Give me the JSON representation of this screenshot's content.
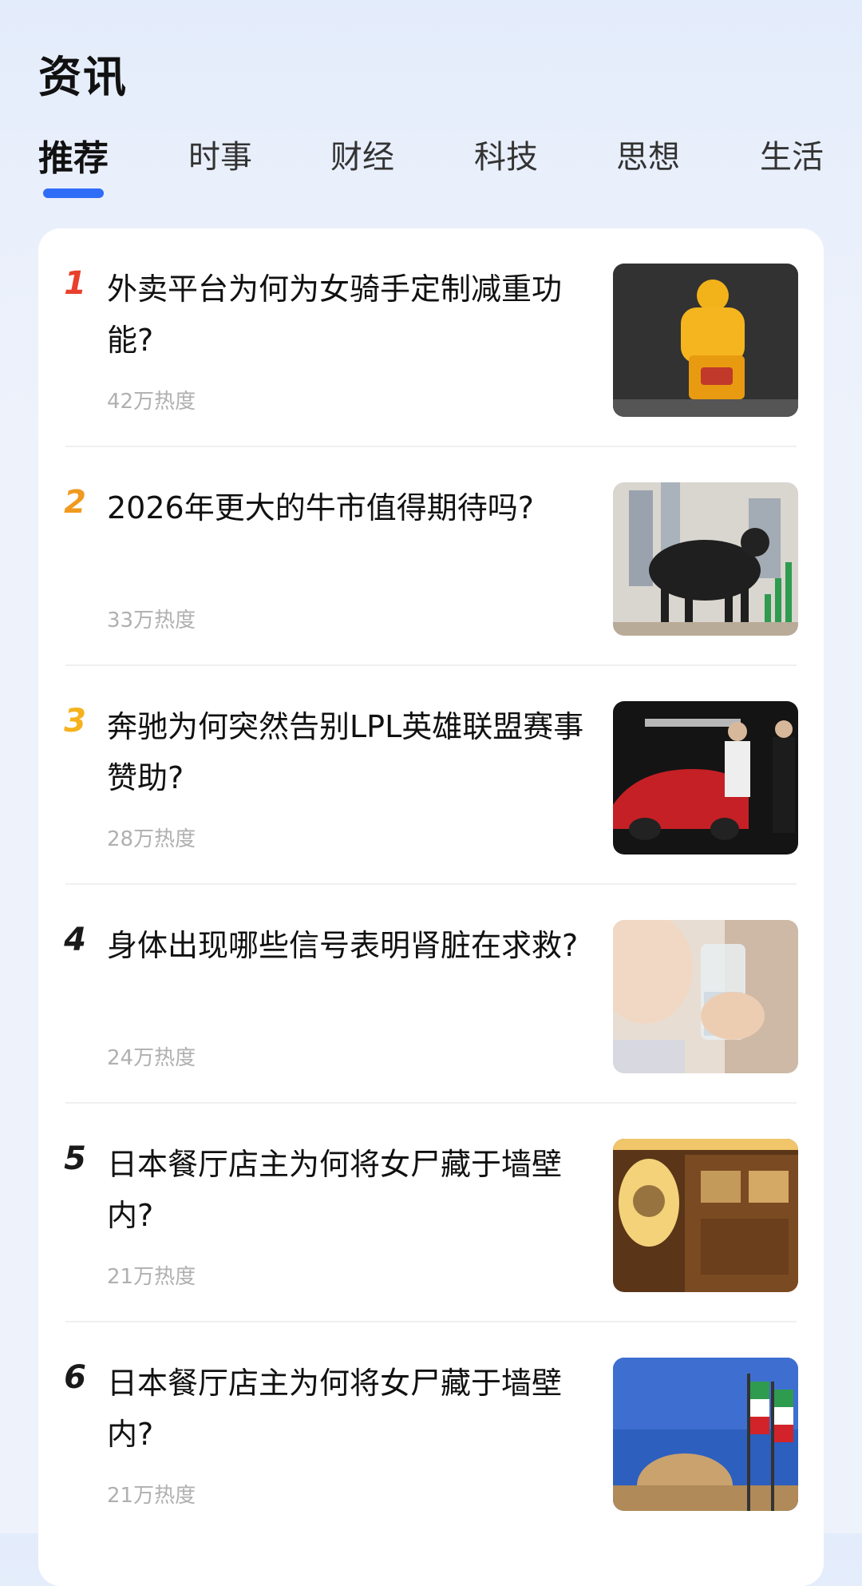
{
  "header": {
    "title": "资讯"
  },
  "tabs": [
    {
      "label": "推荐",
      "active": true
    },
    {
      "label": "时事"
    },
    {
      "label": "财经"
    },
    {
      "label": "科技"
    },
    {
      "label": "思想"
    },
    {
      "label": "生活"
    }
  ],
  "accent_color": "#2f6df6",
  "rank_colors": {
    "1": "#e8402c",
    "2": "#f09a20",
    "3": "#f5b21e",
    "other": "#1a1a1a"
  },
  "news": [
    {
      "rank": "1",
      "title": "外卖平台为何为女骑手定制减重功能?",
      "heat": "42万热度",
      "image": "delivery-rider-image"
    },
    {
      "rank": "2",
      "title": "2026年更大的牛市值得期待吗?",
      "heat": "33万热度",
      "image": "bull-market-image"
    },
    {
      "rank": "3",
      "title": "奔驰为何突然告别LPL英雄联盟赛事赞助?",
      "heat": "28万热度",
      "image": "car-event-image"
    },
    {
      "rank": "4",
      "title": "身体出现哪些信号表明肾脏在求救?",
      "heat": "24万热度",
      "image": "drinking-water-image"
    },
    {
      "rank": "5",
      "title": "日本餐厅店主为何将女尸藏于墙壁内?",
      "heat": "21万热度",
      "image": "restaurant-image"
    },
    {
      "rank": "6",
      "title": "日本餐厅店主为何将女尸藏于墙壁内?",
      "heat": "21万热度",
      "image": "flags-building-image"
    }
  ]
}
